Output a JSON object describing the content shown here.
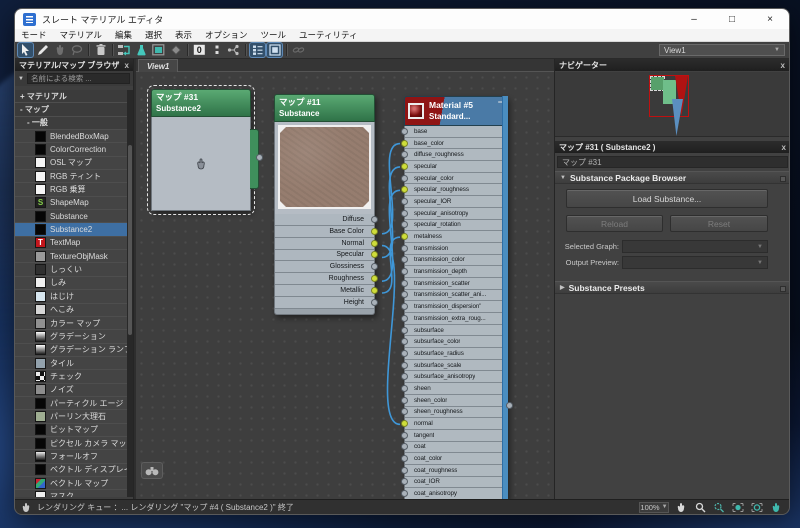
{
  "window": {
    "title": "スレート マテリアル エディタ",
    "controls": {
      "minimize": "–",
      "maximize": "□",
      "close": "×"
    }
  },
  "menu": {
    "items": [
      "モード",
      "マテリアル",
      "編集",
      "選択",
      "表示",
      "オプション",
      "ツール",
      "ユーティリティ"
    ]
  },
  "toolbar": {
    "view_selector": "View1",
    "zero_icon_label": "0"
  },
  "icons": {
    "dropdown": "▼",
    "expanded_arrow": "▼",
    "collapsed_arrow": "▶",
    "select_arrow": "▾"
  },
  "browser": {
    "title": "マテリアル/マップ ブラウザ",
    "close": "x",
    "search_placeholder": "名前による検索 ...",
    "rows": [
      {
        "label": "+ マテリアル",
        "type": "group"
      },
      {
        "label": "- マップ",
        "type": "group"
      },
      {
        "label": "- 一般",
        "type": "sub"
      },
      {
        "label": "BlendedBoxMap",
        "type": "item",
        "swatch": "#060606"
      },
      {
        "label": "ColorCorrection",
        "type": "item",
        "swatch": "#060606"
      },
      {
        "label": "OSL マップ",
        "type": "item",
        "swatch": "#f5f5f5"
      },
      {
        "label": "RGB ティント",
        "type": "item",
        "swatch": "#f5f5f5"
      },
      {
        "label": "RGB 乗算",
        "type": "item",
        "swatch": "#f5f5f5"
      },
      {
        "label": "ShapeMap",
        "type": "item",
        "swatch": "shapemap",
        "glyph": "S"
      },
      {
        "label": "Substance",
        "type": "item",
        "swatch": "#060606"
      },
      {
        "label": "Substance2",
        "type": "item",
        "swatch": "#060606",
        "selected": true
      },
      {
        "label": "TextMap",
        "type": "item",
        "swatch": "textmap",
        "glyph": "T"
      },
      {
        "label": "TextureObjMask",
        "type": "item",
        "swatch": "#9a9a9a"
      },
      {
        "label": "しっくい",
        "type": "item",
        "swatch": "noise-dark"
      },
      {
        "label": "しみ",
        "type": "item",
        "swatch": "#f0f0f0"
      },
      {
        "label": "はじけ",
        "type": "item",
        "swatch": "speckle"
      },
      {
        "label": "へこみ",
        "type": "item",
        "swatch": "noise-light"
      },
      {
        "label": "カラー マップ",
        "type": "item",
        "swatch": "#909090"
      },
      {
        "label": "グラデーション",
        "type": "item",
        "swatch": "gradient"
      },
      {
        "label": "グラデーション ランプ",
        "type": "item",
        "swatch": "gradient"
      },
      {
        "label": "タイル",
        "type": "item",
        "swatch": "tiles"
      },
      {
        "label": "チェック",
        "type": "item",
        "swatch": "checker"
      },
      {
        "label": "ノイズ",
        "type": "item",
        "swatch": "noise-mid"
      },
      {
        "label": "パーティクル エージ",
        "type": "item",
        "swatch": "#060606"
      },
      {
        "label": "パーリン大理石",
        "type": "item",
        "swatch": "marble"
      },
      {
        "label": "ビットマップ",
        "type": "item",
        "swatch": "#060606"
      },
      {
        "label": "ピクセル カメラ マップ",
        "type": "item",
        "swatch": "#060606"
      },
      {
        "label": "フォールオフ",
        "type": "item",
        "swatch": "falloff"
      },
      {
        "label": "ベクトル ディスプレイ ...",
        "type": "item",
        "swatch": "#060606"
      },
      {
        "label": "ベクトル マップ",
        "type": "item",
        "swatch": "vector"
      },
      {
        "label": "マスク",
        "type": "item",
        "swatch": "#f0f0f0"
      }
    ]
  },
  "canvas": {
    "tab": "View1"
  },
  "nodes": {
    "substance2": {
      "title": "マップ #31",
      "subtitle": "Substance2"
    },
    "substance": {
      "title": "マップ #11",
      "subtitle": "Substance",
      "outputs": [
        {
          "label": "Diffuse",
          "connected": false
        },
        {
          "label": "Base Color",
          "connected": true
        },
        {
          "label": "Normal",
          "connected": true
        },
        {
          "label": "Specular",
          "connected": true
        },
        {
          "label": "Glossiness",
          "connected": false
        },
        {
          "label": "Roughness",
          "connected": true
        },
        {
          "label": "Metallic",
          "connected": true
        },
        {
          "label": "Height",
          "connected": false
        }
      ]
    },
    "material": {
      "title": "Material #5",
      "subtitle": "Standard...",
      "collapse_glyph": "−",
      "inputs": [
        {
          "label": "base",
          "connected": false
        },
        {
          "label": "base_color",
          "connected": true
        },
        {
          "label": "diffuse_roughness",
          "connected": false
        },
        {
          "label": "specular",
          "connected": true
        },
        {
          "label": "specular_color",
          "connected": false
        },
        {
          "label": "specular_roughness",
          "connected": true
        },
        {
          "label": "specular_IOR",
          "connected": false
        },
        {
          "label": "specular_anisotropy",
          "connected": false
        },
        {
          "label": "specular_rotation",
          "connected": false
        },
        {
          "label": "metalness",
          "connected": true
        },
        {
          "label": "transmission",
          "connected": false
        },
        {
          "label": "transmission_color",
          "connected": false
        },
        {
          "label": "transmission_depth",
          "connected": false
        },
        {
          "label": "transmission_scatter",
          "connected": false
        },
        {
          "label": "transmission_scatter_ani...",
          "connected": false
        },
        {
          "label": "transmission_dispersion\"",
          "connected": false
        },
        {
          "label": "transmission_extra_roug...",
          "connected": false
        },
        {
          "label": "subsurface",
          "connected": false
        },
        {
          "label": "subsurface_color",
          "connected": false
        },
        {
          "label": "subsurface_radius",
          "connected": false
        },
        {
          "label": "subsurface_scale",
          "connected": false
        },
        {
          "label": "subsurface_anisotropy",
          "connected": false
        },
        {
          "label": "sheen",
          "connected": false
        },
        {
          "label": "sheen_color",
          "connected": false
        },
        {
          "label": "sheen_roughness",
          "connected": false
        },
        {
          "label": "normal",
          "connected": true
        },
        {
          "label": "tangent",
          "connected": false
        },
        {
          "label": "coat",
          "connected": false
        },
        {
          "label": "coat_color",
          "connected": false
        },
        {
          "label": "coat_roughness",
          "connected": false
        },
        {
          "label": "coat_IOR",
          "connected": false
        },
        {
          "label": "coat_anisotropy",
          "connected": false
        }
      ]
    }
  },
  "connections": [
    {
      "from": "Base Color",
      "to": "base_color"
    },
    {
      "from": "Normal",
      "to": "normal"
    },
    {
      "from": "Specular",
      "to": "specular"
    },
    {
      "from": "Roughness",
      "to": "specular_roughness"
    },
    {
      "from": "Metallic",
      "to": "metalness"
    }
  ],
  "navigator": {
    "title": "ナビゲーター",
    "close": "x"
  },
  "params": {
    "header": "マップ #31  ( Substance2 )",
    "close": "x",
    "name_field": "マップ #31",
    "rollout_package": "Substance Package Browser",
    "load_button": "Load Substance...",
    "reload_button": "Reload",
    "reset_button": "Reset",
    "selected_graph_label": "Selected Graph:",
    "output_preview_label": "Output Preview:",
    "rollout_presets": "Substance Presets"
  },
  "statusbar": {
    "message": "レンダリング キュー ：...  レンダリング \"マップ #4  ( Substance2 )\" 終了",
    "zoom": "100%"
  },
  "colors": {
    "wire": "#3f97d8",
    "socket_connected": "#cfdd3a",
    "socket_free": "#a9b1b9",
    "node_header_green": "#3f8f5c",
    "material_header_blue": "#4a7aa6",
    "material_header_red": "#8f1414",
    "selection_blue": "#3e6fa3"
  }
}
